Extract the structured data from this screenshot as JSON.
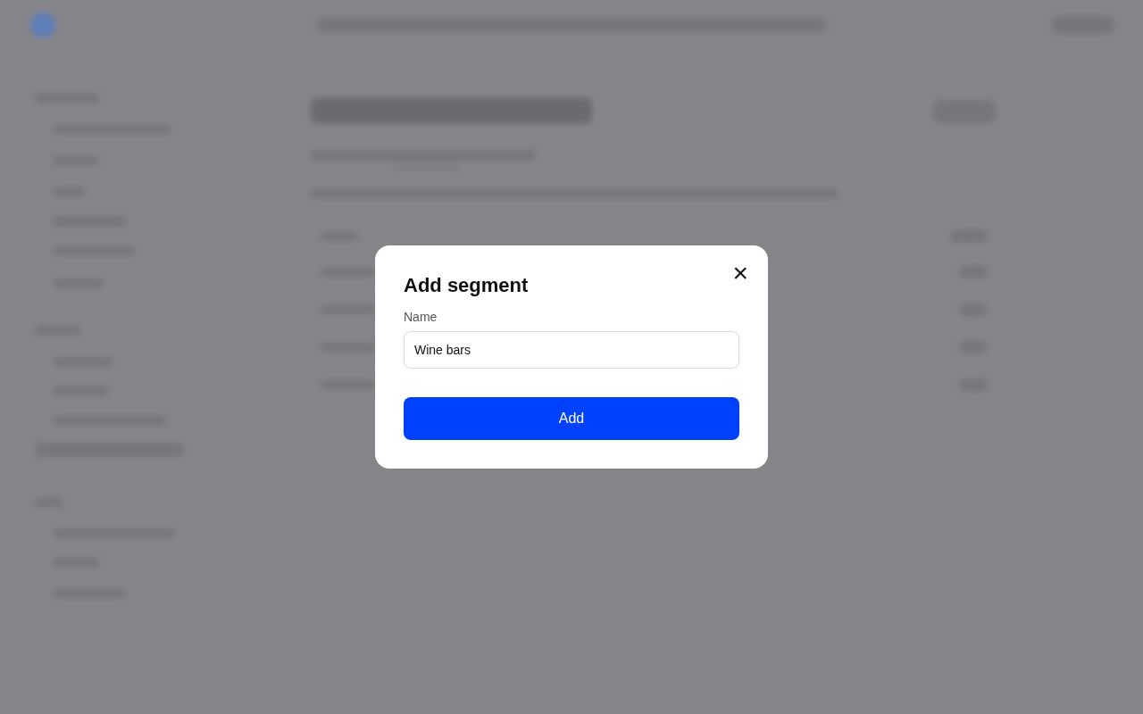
{
  "dialog": {
    "title": "Add segment",
    "close_icon": "×",
    "field": {
      "label": "Name",
      "value": "Wine bars"
    },
    "button": "Add"
  }
}
